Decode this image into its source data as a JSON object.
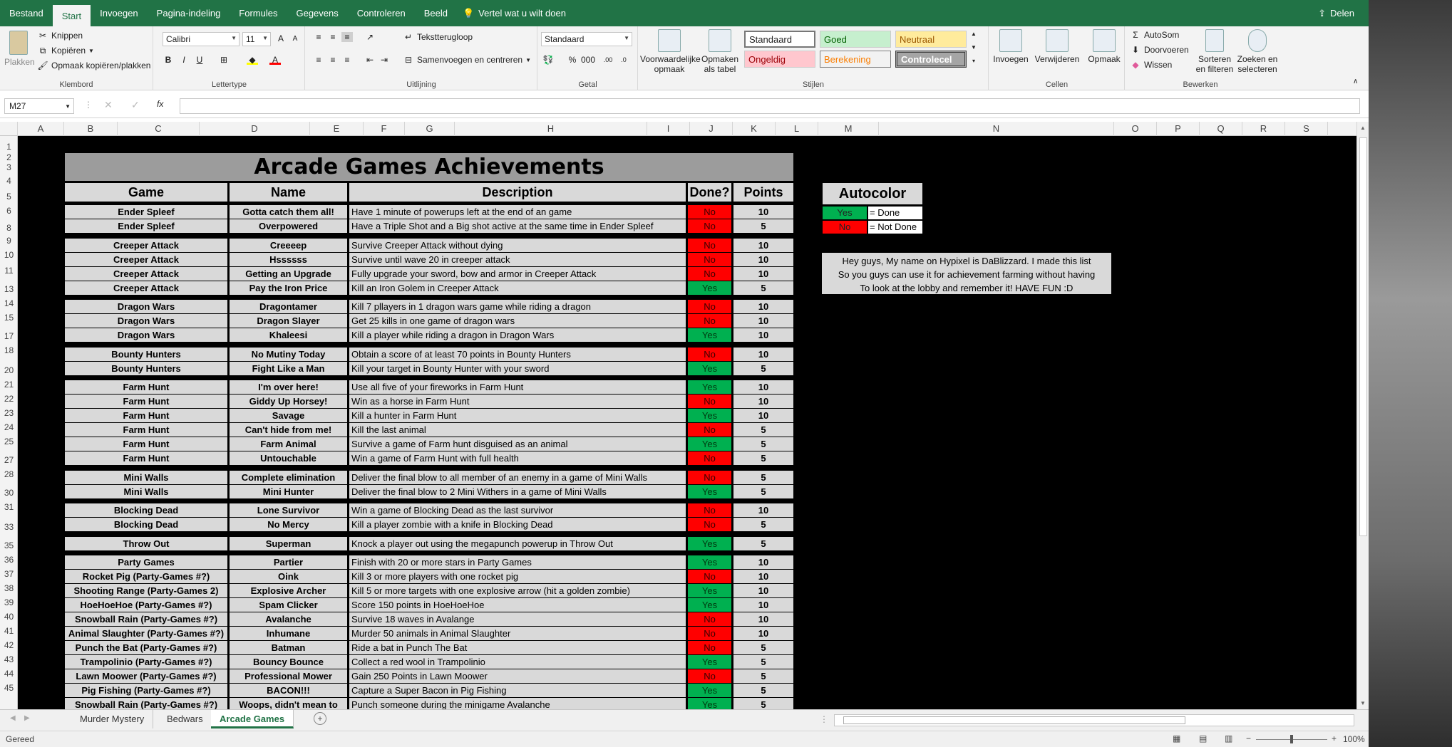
{
  "menu": {
    "tabs": [
      "Bestand",
      "Start",
      "Invoegen",
      "Pagina-indeling",
      "Formules",
      "Gegevens",
      "Controleren",
      "Beeld"
    ],
    "active": "Start",
    "tell_me": "Vertel wat u wilt doen",
    "share": "Delen"
  },
  "ribbon": {
    "clipboard": {
      "paste": "Plakken",
      "cut": "Knippen",
      "copy": "Kopiëren",
      "painter": "Opmaak kopiëren/plakken",
      "label": "Klembord"
    },
    "font": {
      "name": "Calibri",
      "size": "11",
      "label": "Lettertype"
    },
    "align": {
      "wrap": "Tekstterugloop",
      "merge": "Samenvoegen en centreren",
      "label": "Uitlijning"
    },
    "number": {
      "format": "Standaard",
      "label": "Getal"
    },
    "styles": {
      "cond": "Voorwaardelijke opmaak",
      "table": "Opmaken als tabel",
      "cells": [
        "Standaard",
        "Goed",
        "Neutraal",
        "Ongeldig",
        "Berekening",
        "Controlecel"
      ],
      "label": "Stijlen"
    },
    "cells": {
      "insert": "Invoegen",
      "delete": "Verwijderen",
      "format": "Opmaak",
      "label": "Cellen"
    },
    "editing": {
      "autosum": "AutoSom",
      "fill": "Doorvoeren",
      "clear": "Wissen",
      "sort": "Sorteren en filteren",
      "find": "Zoeken en selecteren",
      "label": "Bewerken"
    }
  },
  "formula": {
    "namebox": "M27",
    "fx": "fx",
    "value": ""
  },
  "columns": [
    "A",
    "B",
    "C",
    "D",
    "E",
    "F",
    "G",
    "H",
    "I",
    "J",
    "K",
    "L",
    "M",
    "N",
    "O",
    "P",
    "Q",
    "R",
    "S"
  ],
  "rows": [
    "1",
    "2",
    "3",
    "4",
    "5",
    "6",
    "8",
    "9",
    "10",
    "11",
    "13",
    "14",
    "15",
    "17",
    "18",
    "20",
    "21",
    "22",
    "23",
    "24",
    "25",
    "27",
    "28",
    "30",
    "31",
    "33",
    "35",
    "36",
    "37",
    "38",
    "39",
    "40",
    "41",
    "42",
    "43",
    "44",
    "45"
  ],
  "sheet": {
    "title": "Arcade Games Achievements",
    "headers": {
      "game": "Game",
      "name": "Name",
      "desc": "Description",
      "done": "Done?",
      "points": "Points"
    },
    "rows": [
      {
        "g": "Ender Spleef",
        "n": "Gotta catch them all!",
        "d": "Have 1 minute of powerups left at the end of an game",
        "s": "No",
        "p": "10"
      },
      {
        "g": "Ender Spleef",
        "n": "Overpowered",
        "d": "Have a Triple Shot and a Big shot active at the same time in Ender Spleef",
        "s": "No",
        "p": "5"
      },
      {
        "g": "Creeper Attack",
        "n": "Creeeep",
        "d": "Survive Creeper Attack without dying",
        "s": "No",
        "p": "10"
      },
      {
        "g": "Creeper Attack",
        "n": "Hssssss",
        "d": "Survive until wave 20 in creeper attack",
        "s": "No",
        "p": "10"
      },
      {
        "g": "Creeper Attack",
        "n": "Getting an Upgrade",
        "d": "Fully upgrade your sword, bow and armor in Creeper Attack",
        "s": "No",
        "p": "10"
      },
      {
        "g": "Creeper Attack",
        "n": "Pay the Iron Price",
        "d": "Kill an Iron Golem in Creeper Attack",
        "s": "Yes",
        "p": "5"
      },
      {
        "g": "Dragon Wars",
        "n": "Dragontamer",
        "d": "Kill 7 pllayers in 1 dragon wars game while riding a dragon",
        "s": "No",
        "p": "10"
      },
      {
        "g": "Dragon Wars",
        "n": "Dragon Slayer",
        "d": "Get 25 kills in one game of dragon wars",
        "s": "No",
        "p": "10"
      },
      {
        "g": "Dragon Wars",
        "n": "Khaleesi",
        "d": "Kill a player while riding a dragon in Dragon Wars",
        "s": "Yes",
        "p": "10"
      },
      {
        "g": "Bounty Hunters",
        "n": "No Mutiny Today",
        "d": "Obtain a score of at least 70 points in Bounty Hunters",
        "s": "No",
        "p": "10"
      },
      {
        "g": "Bounty Hunters",
        "n": "Fight Like a Man",
        "d": "Kill your target in Bounty Hunter with your sword",
        "s": "Yes",
        "p": "5"
      },
      {
        "g": "Farm Hunt",
        "n": "I'm over here!",
        "d": "Use all five of your fireworks in Farm Hunt",
        "s": "Yes",
        "p": "10"
      },
      {
        "g": "Farm Hunt",
        "n": "Giddy Up Horsey!",
        "d": "Win as a horse in Farm Hunt",
        "s": "No",
        "p": "10"
      },
      {
        "g": "Farm Hunt",
        "n": "Savage",
        "d": "Kill a hunter in Farm Hunt",
        "s": "Yes",
        "p": "10"
      },
      {
        "g": "Farm Hunt",
        "n": "Can't hide from me!",
        "d": "Kill the last animal",
        "s": "No",
        "p": "5"
      },
      {
        "g": "Farm Hunt",
        "n": "Farm Animal",
        "d": "Survive a game of Farm hunt disguised as an animal",
        "s": "Yes",
        "p": "5"
      },
      {
        "g": "Farm Hunt",
        "n": "Untouchable",
        "d": "Win a game of Farm Hunt with full health",
        "s": "No",
        "p": "5"
      },
      {
        "g": "Mini Walls",
        "n": "Complete elimination",
        "d": "Deliver the final blow to all member of an enemy in a game of Mini Walls",
        "s": "No",
        "p": "5"
      },
      {
        "g": "Mini Walls",
        "n": "Mini Hunter",
        "d": "Deliver the final blow to 2 Mini Withers in a game of Mini Walls",
        "s": "Yes",
        "p": "5"
      },
      {
        "g": "Blocking Dead",
        "n": "Lone Survivor",
        "d": "Win a game of Blocking Dead as the last survivor",
        "s": "No",
        "p": "10"
      },
      {
        "g": "Blocking Dead",
        "n": "No Mercy",
        "d": "Kill a player zombie with a knife in Blocking Dead",
        "s": "No",
        "p": "5"
      },
      {
        "g": "Throw Out",
        "n": "Superman",
        "d": "Knock a player out using the megapunch powerup in Throw Out",
        "s": "Yes",
        "p": "5"
      },
      {
        "g": "Party Games",
        "n": "Partier",
        "d": "Finish with 20 or more stars in Party Games",
        "s": "Yes",
        "p": "10"
      },
      {
        "g": "Rocket Pig (Party-Games #?)",
        "n": "Oink",
        "d": "Kill 3 or more players with one rocket pig",
        "s": "No",
        "p": "10"
      },
      {
        "g": "Shooting Range (Party-Games 2)",
        "n": "Explosive Archer",
        "d": "Kill 5 or more targets with one explosive arrow (hit a golden zombie)",
        "s": "Yes",
        "p": "10"
      },
      {
        "g": "HoeHoeHoe (Party-Games #?)",
        "n": "Spam Clicker",
        "d": "Score 150 points in HoeHoeHoe",
        "s": "Yes",
        "p": "10"
      },
      {
        "g": "Snowball Rain (Party-Games #?)",
        "n": "Avalanche",
        "d": "Survive 18 waves in Avalange",
        "s": "No",
        "p": "10"
      },
      {
        "g": "Animal Slaughter (Party-Games #?)",
        "n": "Inhumane",
        "d": "Murder 50 animals in Animal Slaughter",
        "s": "No",
        "p": "10"
      },
      {
        "g": "Punch the Bat (Party-Games #?)",
        "n": "Batman",
        "d": "Ride a bat in Punch The Bat",
        "s": "No",
        "p": "5"
      },
      {
        "g": "Trampolinio (Party-Games #?)",
        "n": "Bouncy Bounce",
        "d": "Collect a red wool in Trampolinio",
        "s": "Yes",
        "p": "5"
      },
      {
        "g": "Lawn Moower (Party-Games #?)",
        "n": "Professional Mower",
        "d": "Gain 250 Points in Lawn Moower",
        "s": "No",
        "p": "5"
      },
      {
        "g": "Pig Fishing (Party-Games #?)",
        "n": "BACON!!!",
        "d": "Capture a Super Bacon in Pig Fishing",
        "s": "Yes",
        "p": "5"
      },
      {
        "g": "Snowball Rain (Party-Games #?)",
        "n": "Woops, didn't mean to",
        "d": "Punch someone during the minigame Avalanche",
        "s": "Yes",
        "p": "5"
      }
    ],
    "legend": {
      "title": "Autocolor",
      "yes": "Yes",
      "yes_text": "= Done",
      "no": "No",
      "no_text": "= Not Done"
    },
    "note": [
      "Hey guys, My name on Hypixel is DaBlizzard. I made this list",
      "So you guys can use it for achievement farming without having",
      "To look at the lobby and remember it! HAVE FUN :D"
    ]
  },
  "tabs": [
    "Murder Mystery",
    "Bedwars",
    "Arcade Games"
  ],
  "status": {
    "ready": "Gereed",
    "zoom": "100%"
  },
  "colors": {
    "excel_green": "#217346",
    "yes": "#00b050",
    "no": "#ff0000",
    "cell_gray": "#d9d9d9",
    "title_gray": "#9c9c9c"
  }
}
